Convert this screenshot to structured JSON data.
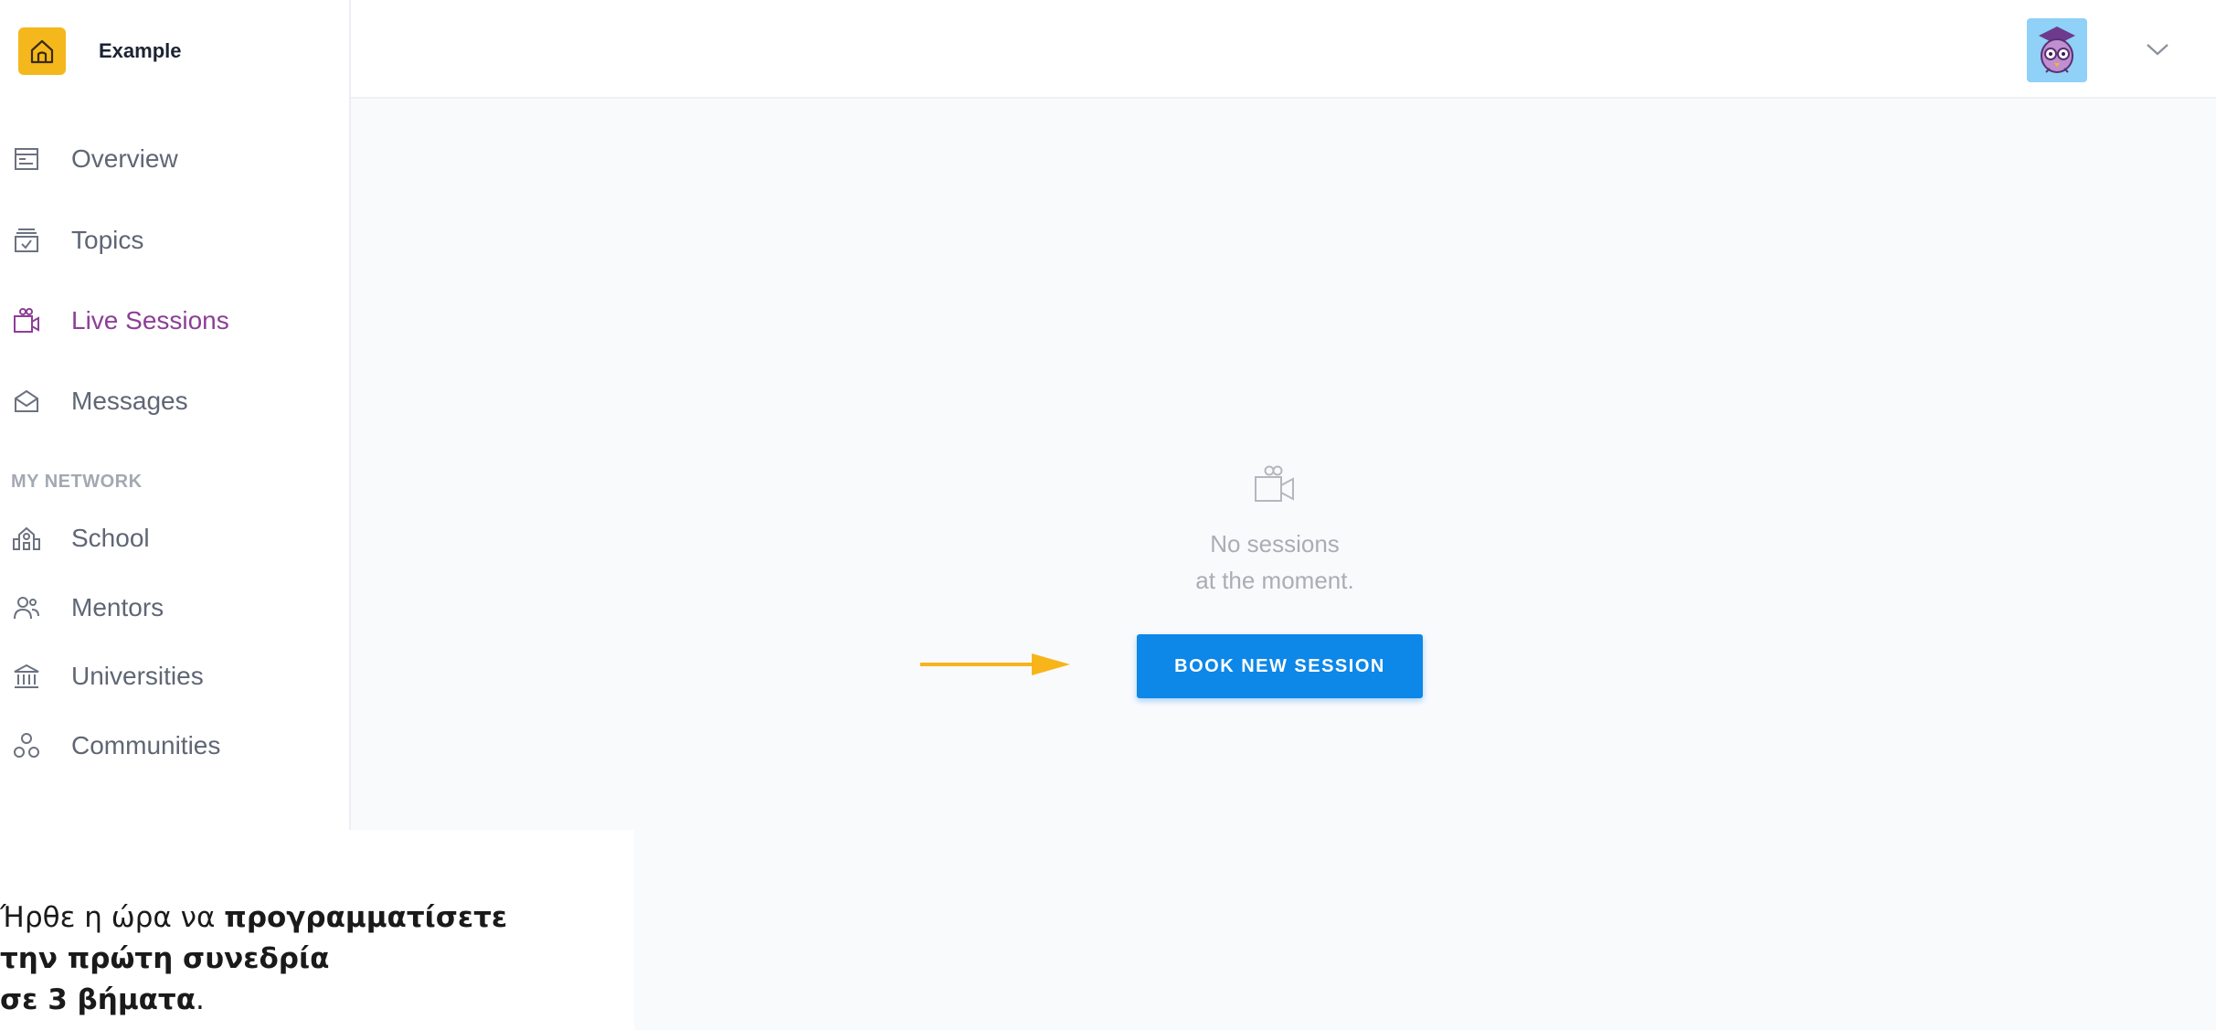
{
  "app": {
    "brand_name": "Example"
  },
  "sidebar": {
    "items": [
      {
        "label": "Overview",
        "icon": "overview-icon"
      },
      {
        "label": "Topics",
        "icon": "topics-icon"
      },
      {
        "label": "Live Sessions",
        "icon": "video-camera-icon",
        "active": true
      },
      {
        "label": "Messages",
        "icon": "envelope-icon"
      }
    ],
    "section_label": "MY NETWORK",
    "network_items": [
      {
        "label": "School",
        "icon": "school-icon"
      },
      {
        "label": "Mentors",
        "icon": "mentors-icon"
      },
      {
        "label": "Universities",
        "icon": "university-icon"
      },
      {
        "label": "Communities",
        "icon": "communities-icon"
      }
    ]
  },
  "main": {
    "empty_line1": "No sessions",
    "empty_line2": "at the moment.",
    "book_button": "BOOK NEW SESSION"
  },
  "caption": {
    "l1a": "Ήρθε η ώρα να ",
    "l1b": "προγραμματίσετε",
    "l2": "την πρώτη συνεδρία",
    "l3a": "σε 3 βήματα",
    "l3b": "."
  },
  "colors": {
    "accent": "#8d3f97",
    "brand": "#f5b81c",
    "button": "#0d87e8",
    "arrow": "#f7b51a"
  }
}
